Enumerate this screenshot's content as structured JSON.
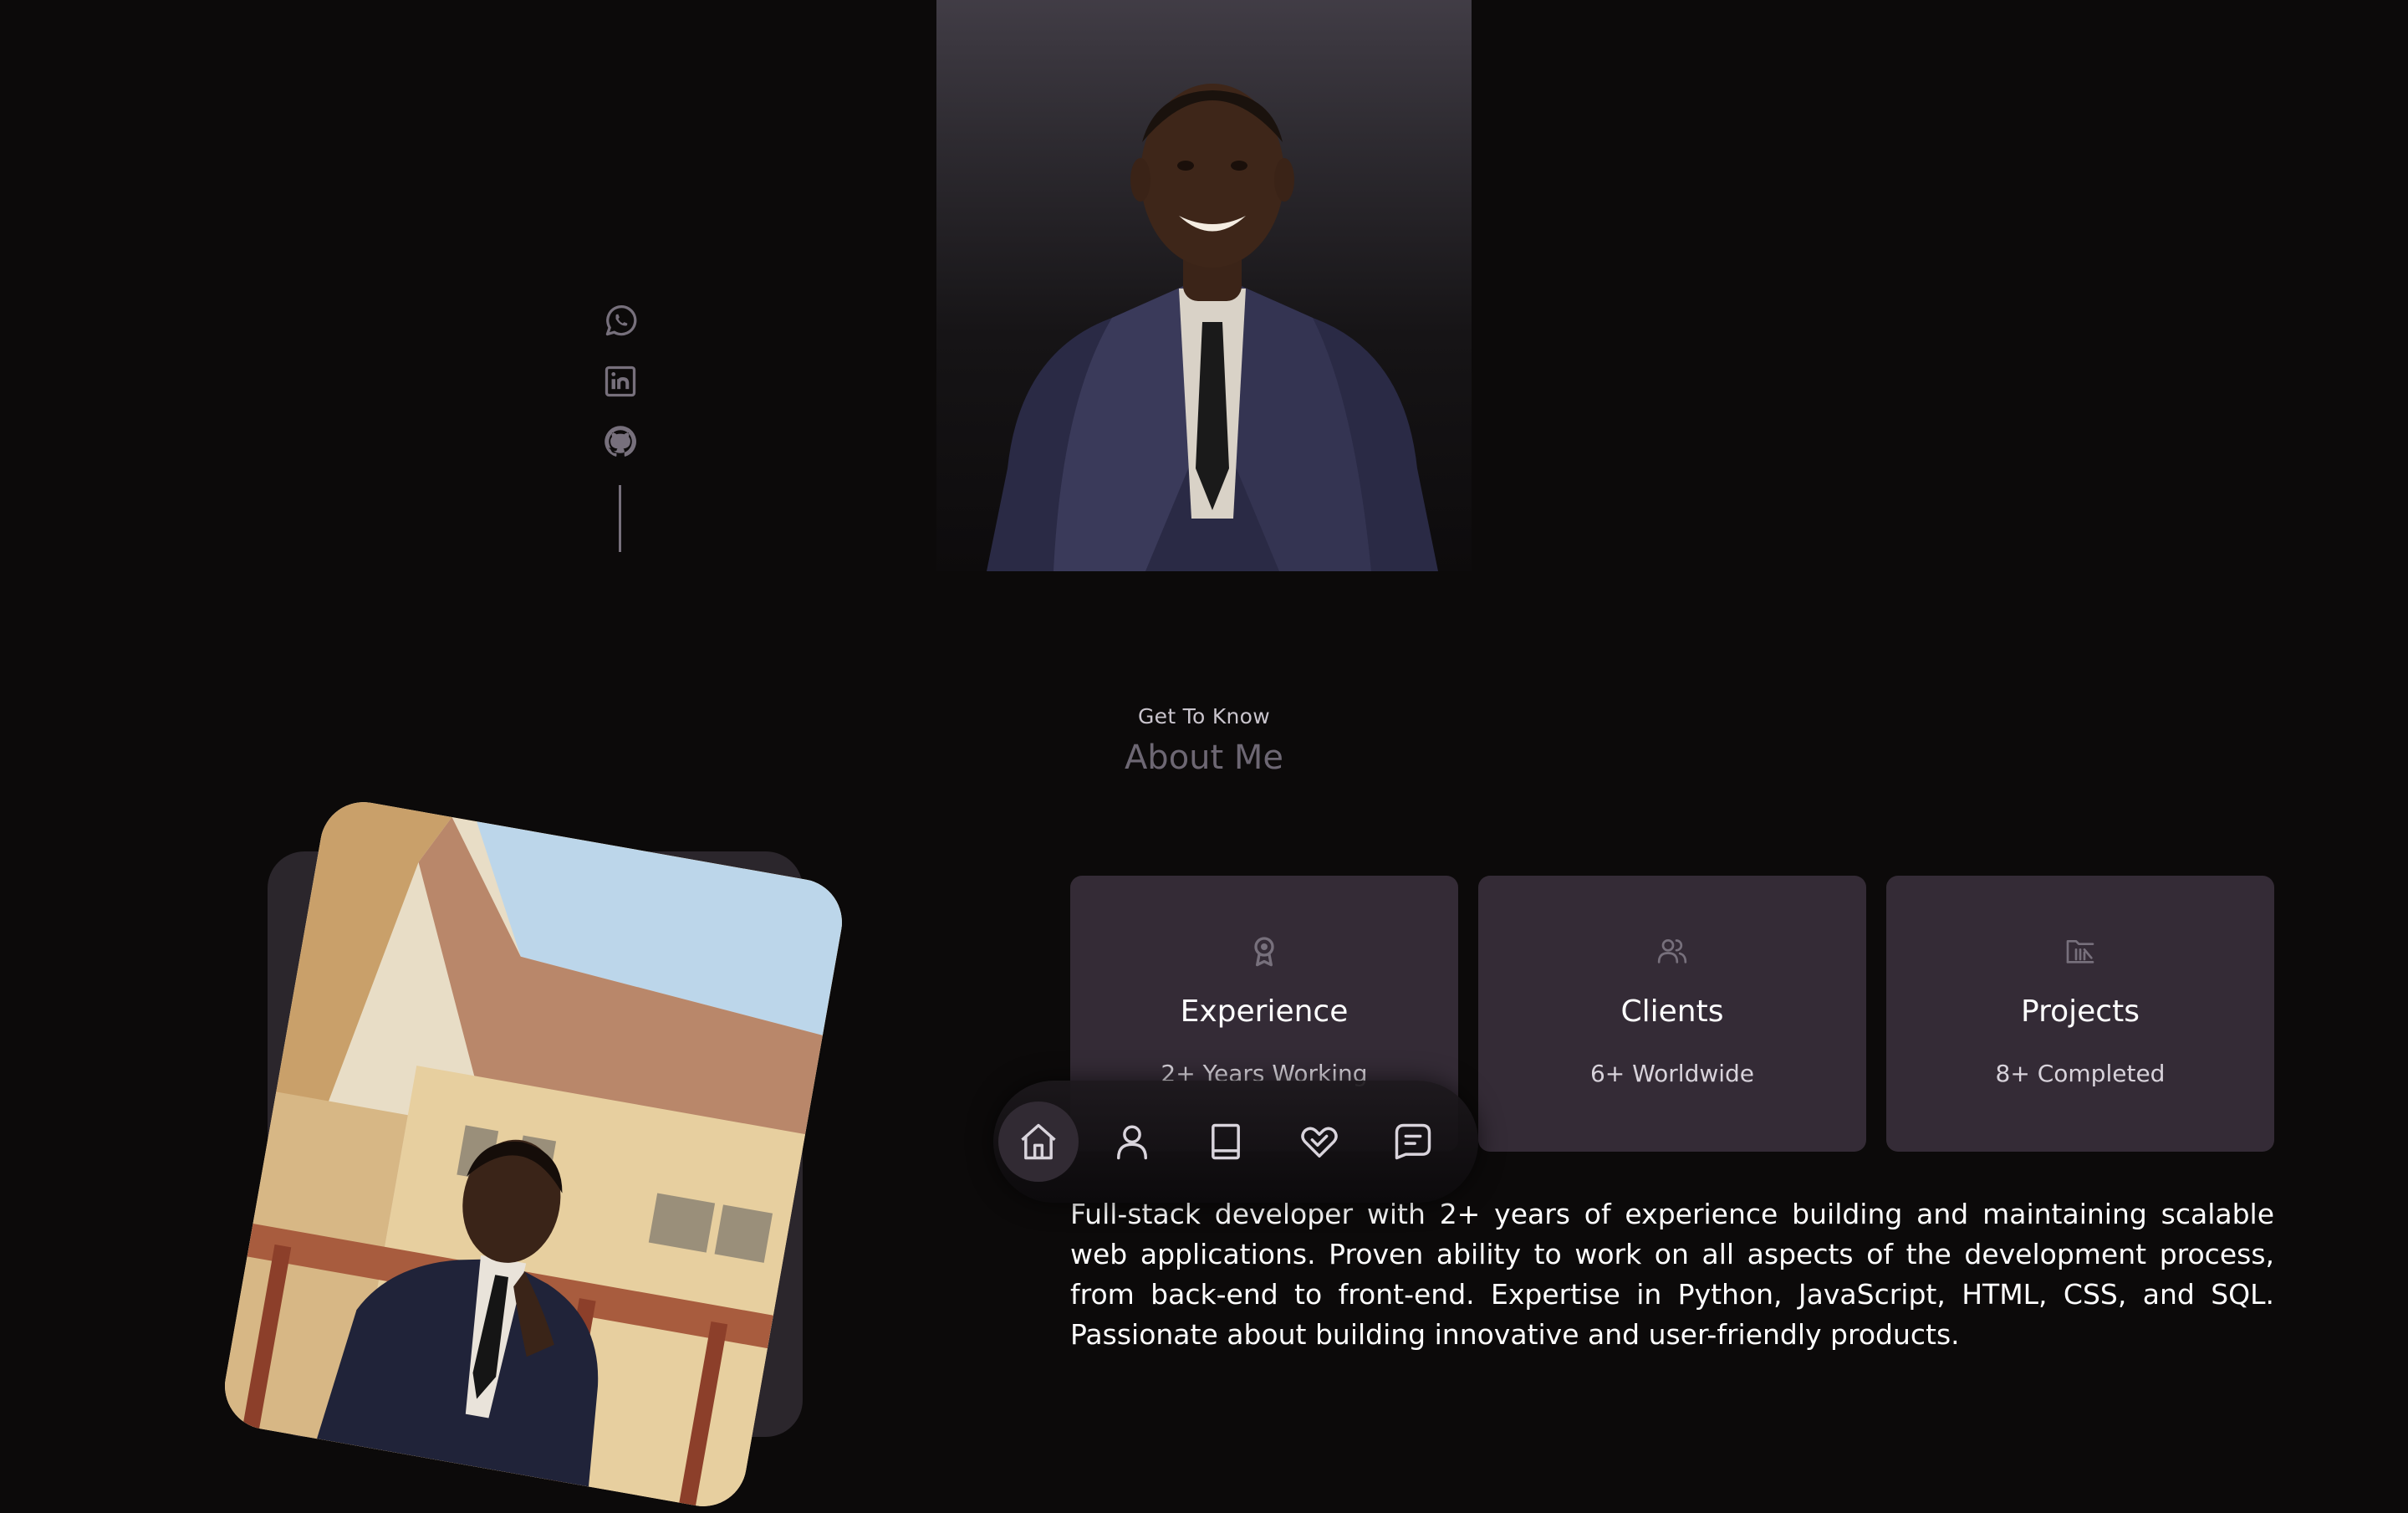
{
  "header": {
    "socials": [
      {
        "name": "whatsapp-icon"
      },
      {
        "name": "linkedin-icon"
      },
      {
        "name": "github-icon"
      }
    ]
  },
  "about": {
    "kicker": "Get To Know",
    "title": "About Me",
    "cards": [
      {
        "icon": "award-icon",
        "title": "Experience",
        "subtitle": "2+ Years Working"
      },
      {
        "icon": "users-icon",
        "title": "Clients",
        "subtitle": "6+ Worldwide"
      },
      {
        "icon": "folder-icon",
        "title": "Projects",
        "subtitle": "8+ Completed"
      }
    ],
    "bio": "Full-stack developer with 2+ years of experience building and maintaining scalable web applications. Proven ability to work on all aspects of the development process, from back-end to front-end. Expertise in Python, JavaScript, HTML, CSS, and SQL. Passionate about building innovative and user-friendly products."
  },
  "nav": {
    "items": [
      {
        "icon": "home-icon",
        "active": true
      },
      {
        "icon": "user-icon",
        "active": false
      },
      {
        "icon": "book-icon",
        "active": false
      },
      {
        "icon": "services-icon",
        "active": false
      },
      {
        "icon": "message-icon",
        "active": false
      }
    ]
  },
  "colors": {
    "background": "#0c0a0a",
    "card": "#342b36",
    "muted": "#77707c",
    "nav_active": "#312a33"
  }
}
